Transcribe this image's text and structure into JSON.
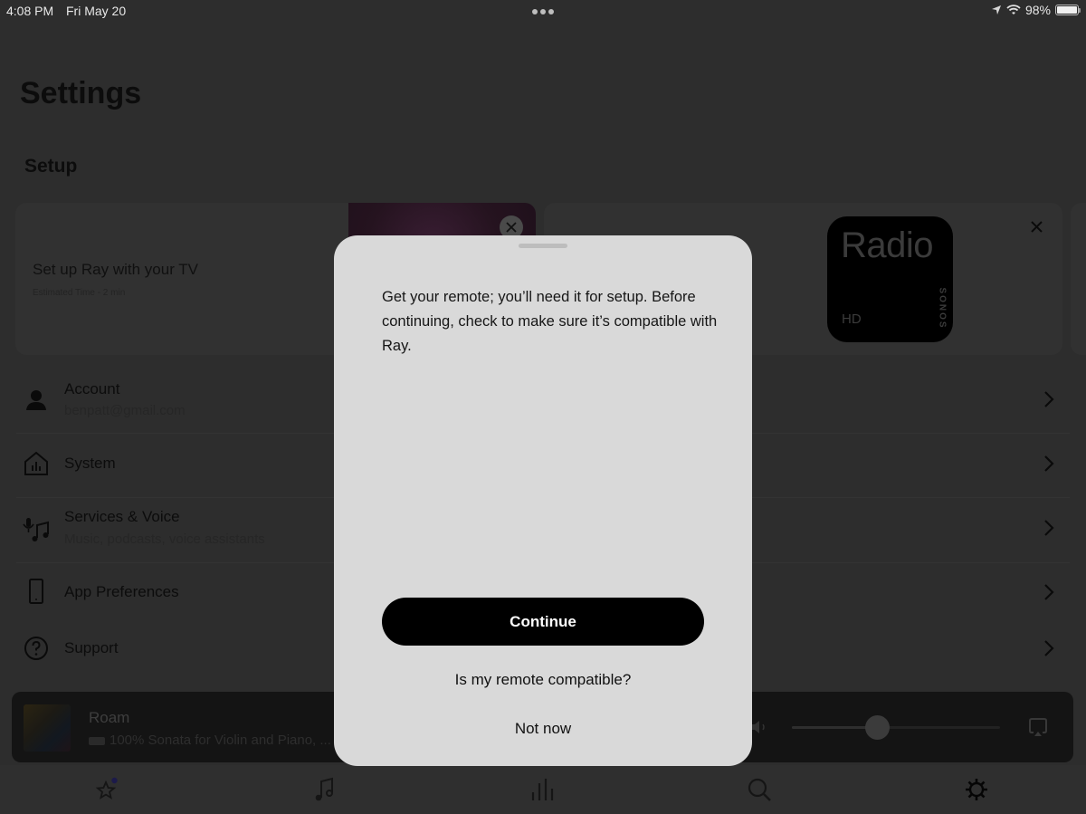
{
  "status_bar": {
    "time": "4:08 PM",
    "date": "Fri May 20",
    "battery": "98%",
    "battery_level": 0.98
  },
  "page": {
    "title": "Settings",
    "section": "Setup"
  },
  "setup_cards": [
    {
      "title": "Set up Ray with your TV",
      "subtitle": "Estimated Time - 2 min",
      "close_icon": "close-icon"
    },
    {
      "tile_word": "Radio",
      "tile_hd": "HD",
      "tile_brand": "SONOS",
      "close_icon": "close-icon"
    }
  ],
  "menu": {
    "items": [
      {
        "label": "Account",
        "subtitle": "benpatt@gmail.com",
        "icon": "person-icon"
      },
      {
        "label": "System",
        "subtitle": "",
        "icon": "home-icon"
      },
      {
        "label": "Services & Voice",
        "subtitle": "Music, podcasts, voice assistants",
        "icon": "mic-music-icon"
      },
      {
        "label": "App Preferences",
        "subtitle": "",
        "icon": "phone-icon"
      },
      {
        "label": "Support",
        "subtitle": "",
        "icon": "help-icon"
      }
    ]
  },
  "now_playing": {
    "room": "Roam",
    "track": "100% Sonata for Violin and Piano, ...",
    "volume": 0.41
  },
  "tabs": [
    {
      "name": "favorites",
      "icon": "star-icon"
    },
    {
      "name": "browse",
      "icon": "music-note-icon"
    },
    {
      "name": "rooms",
      "icon": "bars-icon"
    },
    {
      "name": "search",
      "icon": "search-icon"
    },
    {
      "name": "settings",
      "icon": "gear-icon",
      "active": true
    }
  ],
  "modal": {
    "body": "Get your remote; you’ll need it for setup. Before continuing, check to make sure it’s compatible with Ray.",
    "continue_label": "Continue",
    "compatibility_link": "Is my remote compatible?",
    "not_now_label": "Not now"
  },
  "colors": {
    "backdrop": "#2d2d2d",
    "modal_bg": "#d9d9d9",
    "primary_button": "#000000",
    "notification_dot": "#1c1a4a"
  }
}
